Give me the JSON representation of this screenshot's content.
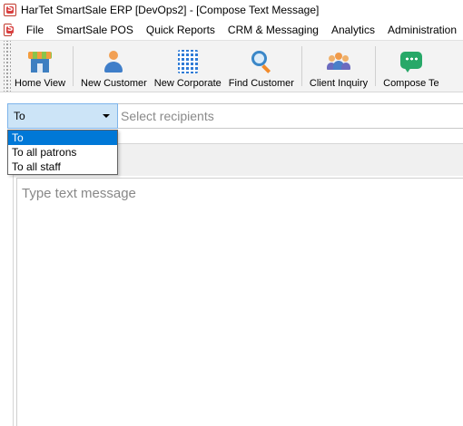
{
  "window": {
    "title": "HarTet SmartSale ERP [DevOps2] - [Compose Text Message]"
  },
  "menu": {
    "items": [
      "File",
      "SmartSale POS",
      "Quick Reports",
      "CRM & Messaging",
      "Analytics",
      "Administration"
    ]
  },
  "toolbar": {
    "buttons": [
      {
        "label": "Home View",
        "icon": "store-icon"
      },
      {
        "label": "New Customer",
        "icon": "person-icon"
      },
      {
        "label": "New Corporate",
        "icon": "building-icon"
      },
      {
        "label": "Find Customer",
        "icon": "search-icon"
      },
      {
        "label": "Client Inquiry",
        "icon": "group-icon"
      },
      {
        "label": "Compose Te",
        "icon": "chat-icon"
      }
    ]
  },
  "recipients": {
    "selected": "To",
    "placeholder": "Select recipients",
    "options": [
      "To",
      "To all patrons",
      "To all staff"
    ]
  },
  "message": {
    "placeholder": "Type text message"
  },
  "colors": {
    "combo_bg": "#cce4f7",
    "selection": "#0078d7",
    "logo": "#d94040"
  }
}
